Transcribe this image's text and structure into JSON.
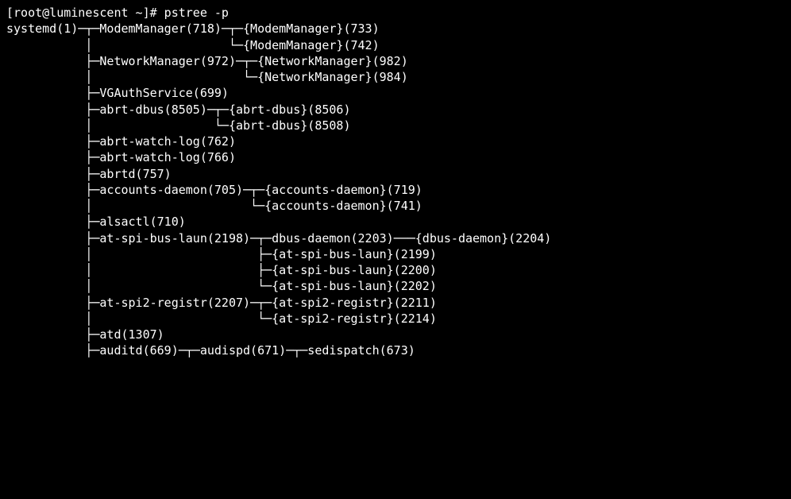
{
  "prompt": "[root@luminescent ~]# ",
  "command": "pstree -p",
  "indent_root": "systemd(1)",
  "tree_lines": [
    "systemd(1)─┬─ModemManager(718)─┬─{ModemManager}(733)",
    "           │                   └─{ModemManager}(742)",
    "           ├─NetworkManager(972)─┬─{NetworkManager}(982)",
    "           │                     └─{NetworkManager}(984)",
    "           ├─VGAuthService(699)",
    "           ├─abrt-dbus(8505)─┬─{abrt-dbus}(8506)",
    "           │                 └─{abrt-dbus}(8508)",
    "           ├─abrt-watch-log(762)",
    "           ├─abrt-watch-log(766)",
    "           ├─abrtd(757)",
    "           ├─accounts-daemon(705)─┬─{accounts-daemon}(719)",
    "           │                      └─{accounts-daemon}(741)",
    "           ├─alsactl(710)",
    "           ├─at-spi-bus-laun(2198)─┬─dbus-daemon(2203)───{dbus-daemon}(2204)",
    "           │                       ├─{at-spi-bus-laun}(2199)",
    "           │                       ├─{at-spi-bus-laun}(2200)",
    "           │                       └─{at-spi-bus-laun}(2202)",
    "           ├─at-spi2-registr(2207)─┬─{at-spi2-registr}(2211)",
    "           │                       └─{at-spi2-registr}(2214)",
    "           ├─atd(1307)",
    "           ├─auditd(669)─┬─audispd(671)─┬─sedispatch(673)"
  ],
  "entries": [
    {
      "name": "systemd",
      "pid": 1,
      "thread": false,
      "children": [
        {
          "name": "ModemManager",
          "pid": 718,
          "thread": false,
          "children": [
            {
              "name": "ModemManager",
              "pid": 733,
              "thread": true
            },
            {
              "name": "ModemManager",
              "pid": 742,
              "thread": true
            }
          ]
        },
        {
          "name": "NetworkManager",
          "pid": 972,
          "thread": false,
          "children": [
            {
              "name": "NetworkManager",
              "pid": 982,
              "thread": true
            },
            {
              "name": "NetworkManager",
              "pid": 984,
              "thread": true
            }
          ]
        },
        {
          "name": "VGAuthService",
          "pid": 699,
          "thread": false
        },
        {
          "name": "abrt-dbus",
          "pid": 8505,
          "thread": false,
          "children": [
            {
              "name": "abrt-dbus",
              "pid": 8506,
              "thread": true
            },
            {
              "name": "abrt-dbus",
              "pid": 8508,
              "thread": true
            }
          ]
        },
        {
          "name": "abrt-watch-log",
          "pid": 762,
          "thread": false
        },
        {
          "name": "abrt-watch-log",
          "pid": 766,
          "thread": false
        },
        {
          "name": "abrtd",
          "pid": 757,
          "thread": false
        },
        {
          "name": "accounts-daemon",
          "pid": 705,
          "thread": false,
          "children": [
            {
              "name": "accounts-daemon",
              "pid": 719,
              "thread": true
            },
            {
              "name": "accounts-daemon",
              "pid": 741,
              "thread": true
            }
          ]
        },
        {
          "name": "alsactl",
          "pid": 710,
          "thread": false
        },
        {
          "name": "at-spi-bus-laun",
          "pid": 2198,
          "thread": false,
          "children": [
            {
              "name": "dbus-daemon",
              "pid": 2203,
              "thread": false,
              "children": [
                {
                  "name": "dbus-daemon",
                  "pid": 2204,
                  "thread": true
                }
              ]
            },
            {
              "name": "at-spi-bus-laun",
              "pid": 2199,
              "thread": true
            },
            {
              "name": "at-spi-bus-laun",
              "pid": 2200,
              "thread": true
            },
            {
              "name": "at-spi-bus-laun",
              "pid": 2202,
              "thread": true
            }
          ]
        },
        {
          "name": "at-spi2-registr",
          "pid": 2207,
          "thread": false,
          "children": [
            {
              "name": "at-spi2-registr",
              "pid": 2211,
              "thread": true
            },
            {
              "name": "at-spi2-registr",
              "pid": 2214,
              "thread": true
            }
          ]
        },
        {
          "name": "atd",
          "pid": 1307,
          "thread": false
        },
        {
          "name": "auditd",
          "pid": 669,
          "thread": false,
          "children": [
            {
              "name": "audispd",
              "pid": 671,
              "thread": false,
              "children": [
                {
                  "name": "sedispatch",
                  "pid": 673,
                  "thread": false
                }
              ]
            }
          ]
        }
      ]
    }
  ]
}
